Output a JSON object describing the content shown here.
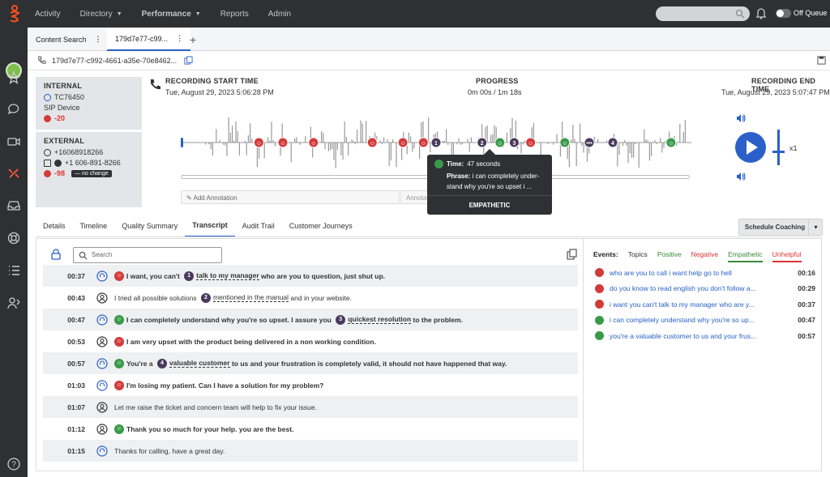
{
  "topnav": {
    "items": [
      {
        "label": "Activity",
        "caret": false,
        "active": false
      },
      {
        "label": "Directory",
        "caret": true,
        "active": false
      },
      {
        "label": "Performance",
        "caret": true,
        "active": true
      },
      {
        "label": "Reports",
        "caret": false,
        "active": false
      },
      {
        "label": "Admin",
        "caret": false,
        "active": false
      }
    ],
    "queue_label": "Off Queue"
  },
  "tabs": {
    "content_search": "Content Search",
    "conversation": "179d7e77-c99..."
  },
  "conversation_id": "179d7e77-c992-4661-a35e-70e8462...",
  "internal": {
    "title": "INTERNAL",
    "user": "TC76450",
    "device": "SIP Device",
    "score": "-20"
  },
  "external": {
    "title": "EXTERNAL",
    "phone": "+16068918266",
    "phone2": "+1 606-891-8266",
    "score": "-98",
    "change": "no change"
  },
  "recording": {
    "start_label": "RECORDING START TIME",
    "start_value": "Tue, August 29, 2023 5:06:28 PM",
    "progress_label": "PROGRESS",
    "progress_value": "0m 00s / 1m 18s",
    "end_label": "RECORDING END TIME",
    "end_value": "Tue, August 29, 2023 5:07:47 PM",
    "speed": "x1"
  },
  "annotation": {
    "add": "Add Annotation",
    "second": "Annotat"
  },
  "tooltip": {
    "time_label": "Time:",
    "time_value": "47 seconds",
    "phrase_label": "Phrase:",
    "phrase_value": "i can completely under-stand why you're so upset i ...",
    "category": "EMPATHETIC"
  },
  "detail_tabs": [
    "Details",
    "Timeline",
    "Quality Summary",
    "Transcript",
    "Audit Trail",
    "Customer Journeys"
  ],
  "schedule_button": "Schedule Coaching",
  "search_placeholder": "Search",
  "transcript": [
    {
      "time": "00:37",
      "who": "agent",
      "badge": "red",
      "bold": true,
      "parts": [
        [
          "I want, you can't ",
          ""
        ],
        [
          "1",
          "num"
        ],
        [
          "talk to my manager",
          "ul"
        ],
        [
          " who are you to question, just shut up.",
          ""
        ]
      ]
    },
    {
      "time": "00:43",
      "who": "customer",
      "badge": "",
      "bold": false,
      "parts": [
        [
          "I tried all possible solutions ",
          ""
        ],
        [
          "2",
          "num"
        ],
        [
          "mentioned in the manual",
          "ul"
        ],
        [
          " and in your website.",
          ""
        ]
      ]
    },
    {
      "time": "00:47",
      "who": "agent",
      "badge": "green",
      "bold": true,
      "parts": [
        [
          "I can completely understand why you're so upset. I assure you ",
          ""
        ],
        [
          "3",
          "num"
        ],
        [
          "quickest resolution",
          "ul"
        ],
        [
          " to the problem.",
          ""
        ]
      ]
    },
    {
      "time": "00:53",
      "who": "customer",
      "badge": "red2",
      "bold": true,
      "parts": [
        [
          "I am very upset with the product being delivered in a non working condition.",
          ""
        ]
      ]
    },
    {
      "time": "00:57",
      "who": "agent",
      "badge": "green",
      "bold": true,
      "parts": [
        [
          "You're a ",
          ""
        ],
        [
          "4",
          "num"
        ],
        [
          "valuable customer",
          "ul"
        ],
        [
          " to us and your frustration is completely valid, it should not have happened that way.",
          ""
        ]
      ]
    },
    {
      "time": "01:03",
      "who": "agent",
      "badge": "red2",
      "bold": true,
      "parts": [
        [
          "I'm losing my patient. Can I have a solution for my problem?",
          ""
        ]
      ]
    },
    {
      "time": "01:07",
      "who": "customer",
      "badge": "",
      "bold": false,
      "parts": [
        [
          "Let me raise the ticket and concern team will help to fix your issue.",
          ""
        ]
      ]
    },
    {
      "time": "01:12",
      "who": "customer",
      "badge": "green2",
      "bold": true,
      "parts": [
        [
          "Thank you so much for your help. you are the best.",
          ""
        ]
      ]
    },
    {
      "time": "01:15",
      "who": "agent",
      "badge": "",
      "bold": false,
      "parts": [
        [
          "Thanks for calling, have a great day.",
          ""
        ]
      ]
    }
  ],
  "events": {
    "header": [
      {
        "label": "Events:",
        "color": "#222",
        "underline": ""
      },
      {
        "label": "Topics",
        "color": "#333",
        "underline": ""
      },
      {
        "label": "Positive",
        "color": "#3a8a3a",
        "underline": ""
      },
      {
        "label": "Negative",
        "color": "#d33",
        "underline": ""
      },
      {
        "label": "Empathetic",
        "color": "#3a8a3a",
        "underline": "#3a8a3a"
      },
      {
        "label": "Unhelpful",
        "color": "#d33",
        "underline": "#d33"
      }
    ],
    "rows": [
      {
        "type": "red",
        "text": "who are you to call i want help go to hell",
        "time": "00:16"
      },
      {
        "type": "red",
        "text": "do you know to read english you don't follow a...",
        "time": "00:29"
      },
      {
        "type": "red",
        "text": "i want you can't talk to my manager who are y...",
        "time": "00:37"
      },
      {
        "type": "green",
        "text": "i can completely understand why you're so up...",
        "time": "00:47"
      },
      {
        "type": "green",
        "text": "you're a valuable customer to us and your frus...",
        "time": "00:57"
      }
    ]
  },
  "colors": {
    "accent": "#2a60c7",
    "negative": "#d33b3b",
    "positive": "#3a9a4a",
    "marker_dark": "#4a3a5c"
  },
  "markers": [
    {
      "t": 0.153,
      "type": "red"
    },
    {
      "t": 0.2,
      "type": "red"
    },
    {
      "t": 0.26,
      "type": "red"
    },
    {
      "t": 0.375,
      "type": "red"
    },
    {
      "t": 0.435,
      "type": "red"
    },
    {
      "t": 0.475,
      "type": "red"
    },
    {
      "t": 0.5,
      "type": "num",
      "label": "1"
    },
    {
      "t": 0.59,
      "type": "num",
      "label": "2"
    },
    {
      "t": 0.625,
      "type": "green"
    },
    {
      "t": 0.653,
      "type": "num",
      "label": "3"
    },
    {
      "t": 0.685,
      "type": "red"
    },
    {
      "t": 0.752,
      "type": "green"
    },
    {
      "t": 0.8,
      "type": "dots"
    },
    {
      "t": 0.846,
      "type": "num",
      "label": "4"
    },
    {
      "t": 0.96,
      "type": "green"
    }
  ]
}
